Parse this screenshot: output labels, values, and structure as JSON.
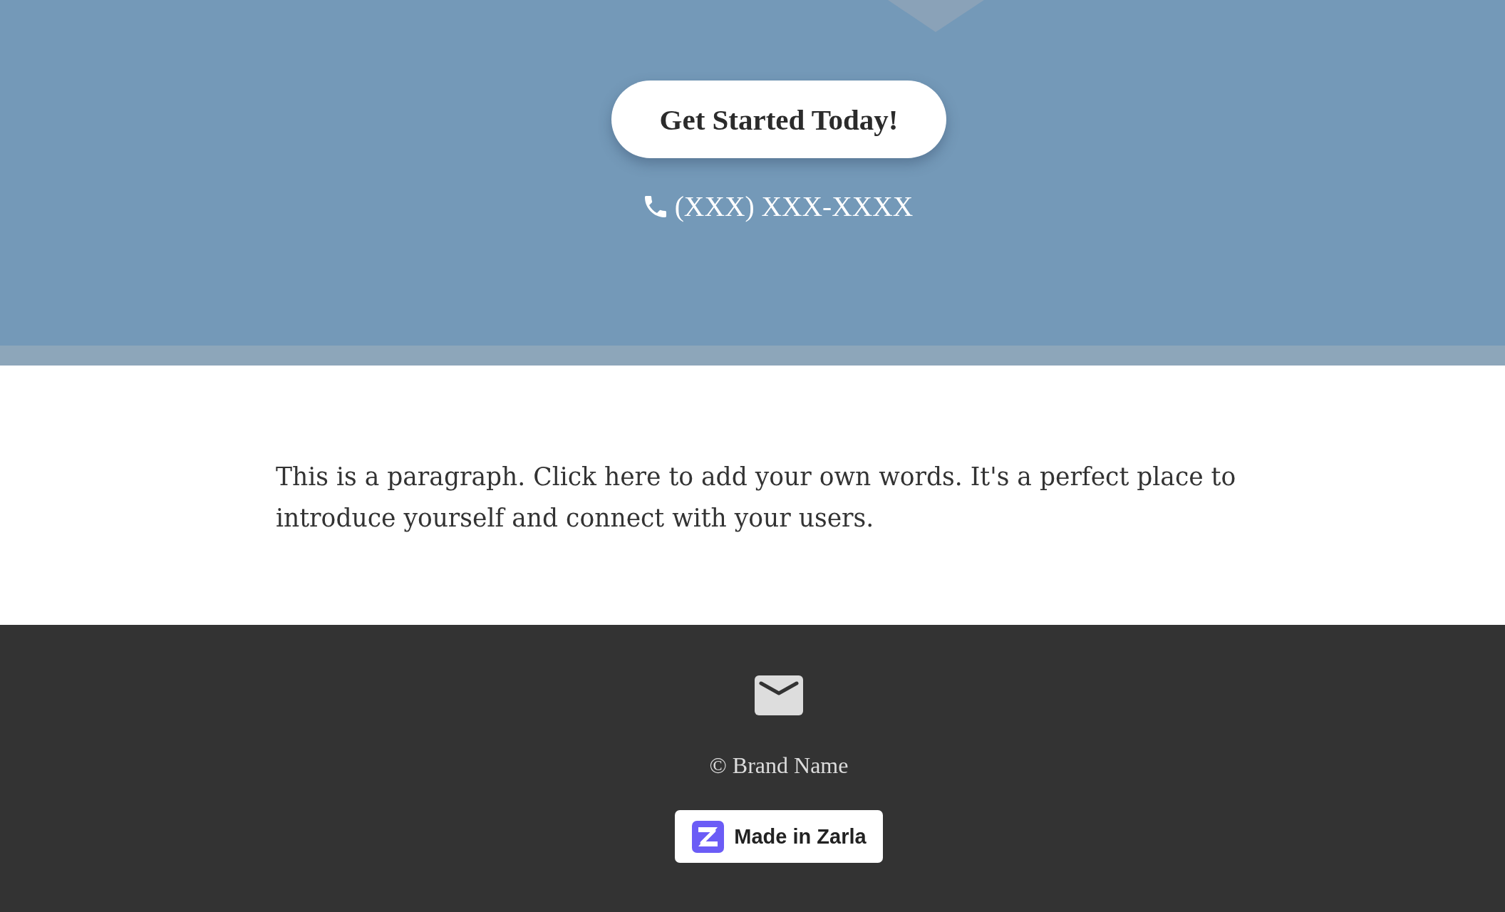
{
  "hero": {
    "cta_button": "Get Started Today!",
    "phone": "(XXX) XXX-XXXX"
  },
  "intro": {
    "paragraph": "This is a paragraph. Click here to add your own words. It's a perfect place to introduce yourself and connect with your users."
  },
  "footer": {
    "copyright": "© Brand Name",
    "badge": "Made in Zarla"
  }
}
